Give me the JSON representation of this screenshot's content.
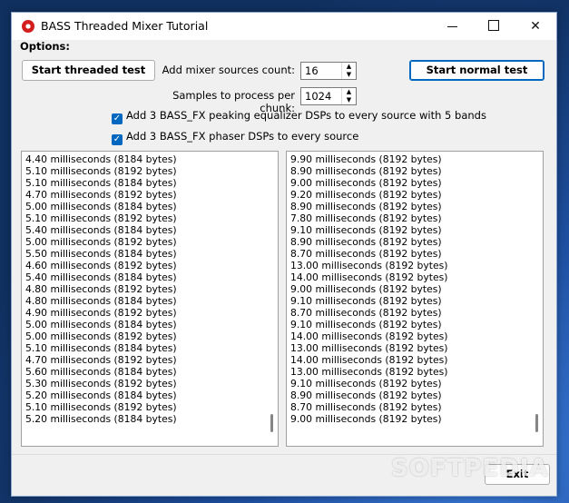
{
  "window": {
    "title": "BASS Threaded Mixer Tutorial",
    "minimize_glyph": "—",
    "close_glyph": "✕"
  },
  "options": {
    "heading": "Options:",
    "start_threaded_label": "Start threaded test",
    "start_normal_label": "Start normal test",
    "sources_count_label": "Add mixer sources count:",
    "sources_count_value": "16",
    "samples_label": "Samples to process per chunk:",
    "samples_value": "1024",
    "peaking_eq_label": "Add 3 BASS_FX peaking equalizer DSPs to every source with 5 bands",
    "phaser_label": "Add 3 BASS_FX phaser DSPs to every source",
    "peaking_eq_checked": true,
    "phaser_checked": true
  },
  "left_list": [
    "4.40 milliseconds (8184 bytes)",
    "5.10 milliseconds (8192 bytes)",
    "5.10 milliseconds (8184 bytes)",
    "4.70 milliseconds (8192 bytes)",
    "5.00 milliseconds (8184 bytes)",
    "5.10 milliseconds (8192 bytes)",
    "5.40 milliseconds (8184 bytes)",
    "5.00 milliseconds (8192 bytes)",
    "5.50 milliseconds (8184 bytes)",
    "4.60 milliseconds (8192 bytes)",
    "5.40 milliseconds (8184 bytes)",
    "4.80 milliseconds (8192 bytes)",
    "4.80 milliseconds (8184 bytes)",
    "4.90 milliseconds (8192 bytes)",
    "5.00 milliseconds (8184 bytes)",
    "5.00 milliseconds (8192 bytes)",
    "5.10 milliseconds (8184 bytes)",
    "4.70 milliseconds (8192 bytes)",
    "5.60 milliseconds (8184 bytes)",
    "5.30 milliseconds (8192 bytes)",
    "5.20 milliseconds (8184 bytes)",
    "5.10 milliseconds (8192 bytes)",
    "5.20 milliseconds (8184 bytes)"
  ],
  "right_list": [
    "9.90 milliseconds (8192 bytes)",
    "8.90 milliseconds (8192 bytes)",
    "9.00 milliseconds (8192 bytes)",
    "9.20 milliseconds (8192 bytes)",
    "8.90 milliseconds (8192 bytes)",
    "7.80 milliseconds (8192 bytes)",
    "9.10 milliseconds (8192 bytes)",
    "8.90 milliseconds (8192 bytes)",
    "8.70 milliseconds (8192 bytes)",
    "13.00 milliseconds (8192 bytes)",
    "14.00 milliseconds (8192 bytes)",
    "9.00 milliseconds (8192 bytes)",
    "9.10 milliseconds (8192 bytes)",
    "8.70 milliseconds (8192 bytes)",
    "9.10 milliseconds (8192 bytes)",
    "14.00 milliseconds (8192 bytes)",
    "13.00 milliseconds (8192 bytes)",
    "14.00 milliseconds (8192 bytes)",
    "13.00 milliseconds (8192 bytes)",
    "9.10 milliseconds (8192 bytes)",
    "8.90 milliseconds (8192 bytes)",
    "8.70 milliseconds (8192 bytes)",
    "9.00 milliseconds (8192 bytes)"
  ],
  "footer": {
    "exit_label": "Exit",
    "watermark": "SOFTPEDIA"
  },
  "colors": {
    "accent": "#0067c0",
    "window_bg": "#f0f0f0"
  }
}
